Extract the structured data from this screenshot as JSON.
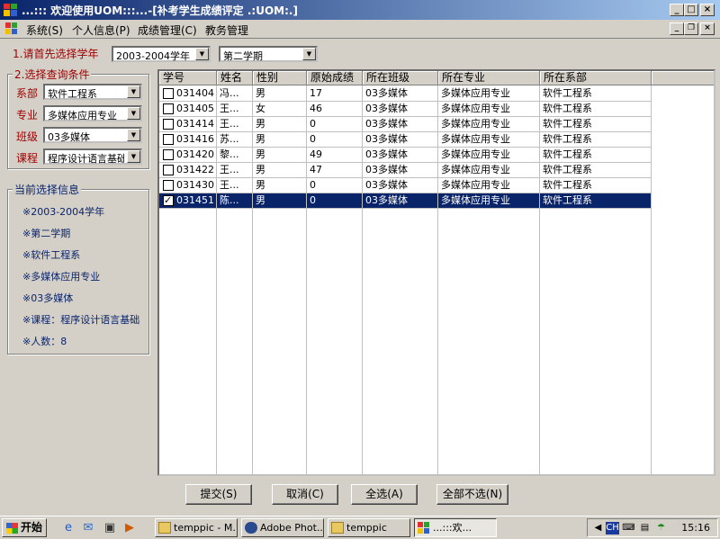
{
  "window": {
    "title": "...::: 欢迎使用UOM:::...-[补考学生成绩评定 .:UOM:.]"
  },
  "menu": {
    "items": [
      "系统(S)",
      "个人信息(P)",
      "成绩管理(C)",
      "教务管理"
    ]
  },
  "filters": {
    "step1_label": "1.请首先选择学年",
    "year": "2003-2004学年",
    "term": "第二学期",
    "step2_label": "2.选择查询条件",
    "dept_label": "系部",
    "dept": "软件工程系",
    "major_label": "专业",
    "major": "多媒体应用专业",
    "class_label": "班级",
    "class": "03多媒体",
    "course_label": "课程",
    "course": "程序设计语言基础"
  },
  "current_info": {
    "caption": "当前选择信息",
    "lines": [
      "※2003-2004学年",
      "※第二学期",
      "※软件工程系",
      "※多媒体应用专业",
      "※03多媒体",
      "※课程：程序设计语言基础",
      "※人数：8"
    ]
  },
  "grid": {
    "columns": [
      "学号",
      "姓名",
      "性别",
      "原始成绩",
      "所在班级",
      "所在专业",
      "所在系部"
    ],
    "rows": [
      {
        "checked": false,
        "id": "031404",
        "name": "冯...",
        "gender": "男",
        "score": "17",
        "class": "03多媒体",
        "major": "多媒体应用专业",
        "dept": "软件工程系"
      },
      {
        "checked": false,
        "id": "031405",
        "name": "王...",
        "gender": "女",
        "score": "46",
        "class": "03多媒体",
        "major": "多媒体应用专业",
        "dept": "软件工程系"
      },
      {
        "checked": false,
        "id": "031414",
        "name": "王...",
        "gender": "男",
        "score": "0",
        "class": "03多媒体",
        "major": "多媒体应用专业",
        "dept": "软件工程系"
      },
      {
        "checked": false,
        "id": "031416",
        "name": "苏...",
        "gender": "男",
        "score": "0",
        "class": "03多媒体",
        "major": "多媒体应用专业",
        "dept": "软件工程系"
      },
      {
        "checked": false,
        "id": "031420",
        "name": "黎...",
        "gender": "男",
        "score": "49",
        "class": "03多媒体",
        "major": "多媒体应用专业",
        "dept": "软件工程系"
      },
      {
        "checked": false,
        "id": "031422",
        "name": "王...",
        "gender": "男",
        "score": "47",
        "class": "03多媒体",
        "major": "多媒体应用专业",
        "dept": "软件工程系"
      },
      {
        "checked": false,
        "id": "031430",
        "name": "王...",
        "gender": "男",
        "score": "0",
        "class": "03多媒体",
        "major": "多媒体应用专业",
        "dept": "软件工程系"
      },
      {
        "checked": true,
        "id": "031451",
        "name": "陈...",
        "gender": "男",
        "score": "0",
        "class": "03多媒体",
        "major": "多媒体应用专业",
        "dept": "软件工程系"
      }
    ]
  },
  "buttons": {
    "submit": "提交(S)",
    "cancel": "取消(C)",
    "select_all": "全选(A)",
    "select_none": "全部不选(N)"
  },
  "taskbar": {
    "start": "开始",
    "tasks": [
      "temppic - M...",
      "Adobe Phot...",
      "temppic",
      "...:::欢..."
    ],
    "ime": "CH",
    "clock": "15:16"
  },
  "colors": {
    "title_start": "#0a246a",
    "title_end": "#a6caf0",
    "label_red": "#a00000",
    "selection": "#0a246a"
  }
}
